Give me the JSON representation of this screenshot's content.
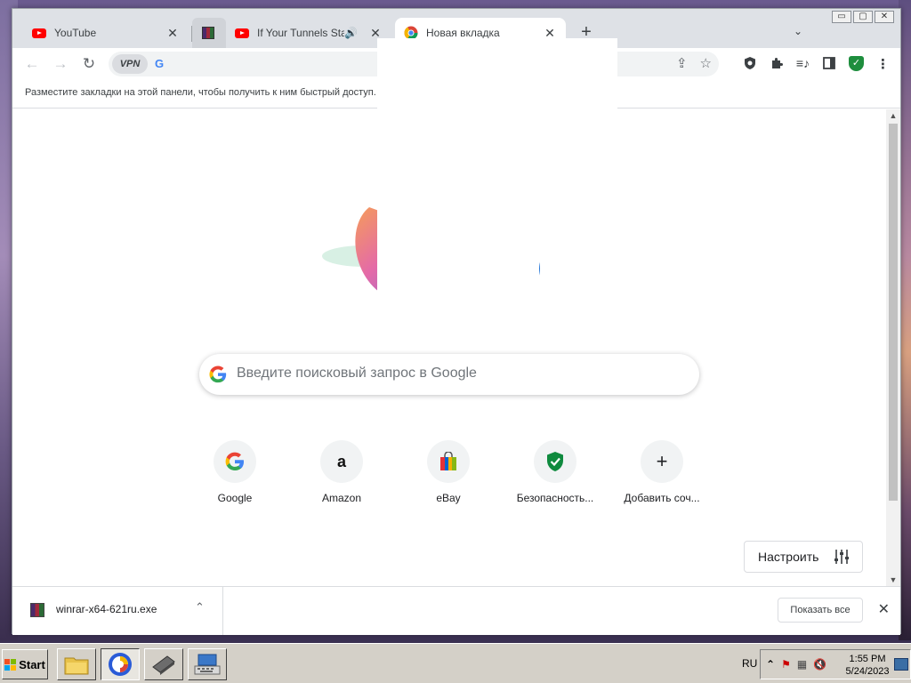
{
  "browser": {
    "tabs": [
      {
        "title": "YouTube",
        "icon": "youtube-icon",
        "active": false
      },
      {
        "title": "",
        "icon": "winrar-icon",
        "active": false
      },
      {
        "title": "If Your Tunnels Start",
        "icon": "youtube-icon",
        "active": false,
        "audio": true
      },
      {
        "title": "Новая вкладка",
        "icon": "chrome-icon",
        "active": true
      }
    ],
    "new_tab_symbol": "+",
    "tab_search_symbol": "⌄",
    "close_symbol": "✕",
    "window_controls": [
      "▭",
      "▢",
      "✕"
    ]
  },
  "toolbar": {
    "back": "←",
    "forward": "→",
    "reload": "↻",
    "vpn_label": "VPN",
    "omnibox_g": "G",
    "share": "⇪",
    "star": "☆",
    "menu": "⋮"
  },
  "bookmarks_bar": {
    "hint": "Разместите закладки на этой панели, чтобы получить к ним быстрый доступ."
  },
  "ntp": {
    "search_placeholder": "Введите поисковый запрос в Google",
    "shortcuts": [
      {
        "label": "Google",
        "icon": "google-g-icon"
      },
      {
        "label": "Amazon",
        "icon": "amazon-icon"
      },
      {
        "label": "eBay",
        "icon": "ebay-bag-icon"
      },
      {
        "label": "Безопасность...",
        "icon": "shield-check-icon"
      },
      {
        "label": "Добавить соч...",
        "icon": "plus-icon"
      }
    ],
    "customize_label": "Настроить"
  },
  "download_bar": {
    "filename": "winrar-x64-621ru.exe",
    "show_all_label": "Показать все",
    "close_symbol": "✕",
    "chevron": "⌃"
  },
  "taskbar": {
    "start_label": "Start",
    "language": "RU",
    "time": "1:55 PM",
    "date": "5/24/2023",
    "tray_arrow": "⌃"
  }
}
